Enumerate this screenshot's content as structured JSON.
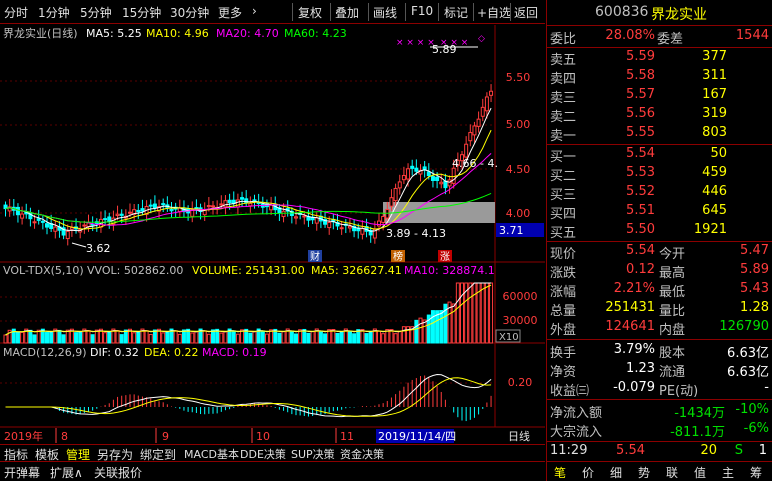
{
  "toolbar": {
    "periods": [
      "分时",
      "1分钟",
      "5分钟",
      "15分钟",
      "30分钟",
      "更多",
      "›"
    ],
    "buttons": [
      "复权",
      "叠加",
      "画线",
      "F10",
      "标记",
      "+自选",
      "返回"
    ]
  },
  "kline": {
    "title": "界龙实业(日线)",
    "ma5": "MA5: 5.25",
    "ma10": "MA10: 4.96",
    "ma20": "MA20: 4.70",
    "ma60": "MA60: 4.23",
    "ticks": [
      "5.50",
      "5.00",
      "4.50",
      "4.00"
    ],
    "high_label": "5.89",
    "low_label": "3.62",
    "range_label": "3.89 - 4.13",
    "mid_label": "4.66 - 4.",
    "price_tag": "3.71",
    "markers": [
      "财",
      "榜",
      "涨"
    ],
    "colors": {
      "ma5": "#ffffff",
      "ma10": "#ffff00",
      "ma20": "#ff00ff",
      "ma60": "#00ff00",
      "up": "#ff3c3c",
      "down": "#00ffff"
    }
  },
  "volume": {
    "title": "VOL-TDX(5,10)",
    "vvol": "VVOL: 502862.00",
    "vol": "VOLUME: 251431.00",
    "ma5": "MA5: 326627.41",
    "ma10": "MA10: 328874.1",
    "ticks": [
      "60000",
      "30000"
    ],
    "unit": "X10"
  },
  "macd": {
    "title": "MACD(12,26,9)",
    "dif": "DIF: 0.32",
    "dea": "DEA: 0.22",
    "macd": "MACD: 0.19",
    "ticks": [
      "0.20"
    ]
  },
  "timeaxis": {
    "labels": [
      "2019年",
      "8",
      "9",
      "10",
      "11"
    ],
    "cursor": "2019/11/14/四",
    "period": "日线"
  },
  "tabs1": [
    "指标",
    "模板",
    "管理",
    "另存为",
    "绑定到",
    "MACD基本",
    "DDE决策",
    "SUP决策",
    "资金决策"
  ],
  "tabs2": [
    "开弹幕",
    "扩展∧",
    "关联报价"
  ],
  "panel": {
    "code": "600836",
    "name": "界龙实业",
    "weibi_label": "委比",
    "weibi": "28.08%",
    "weicha_label": "委差",
    "weicha": "1544",
    "sells": [
      {
        "label": "卖五",
        "price": "5.59",
        "vol": "377"
      },
      {
        "label": "卖四",
        "price": "5.58",
        "vol": "311"
      },
      {
        "label": "卖三",
        "price": "5.57",
        "vol": "167"
      },
      {
        "label": "卖二",
        "price": "5.56",
        "vol": "319"
      },
      {
        "label": "卖一",
        "price": "5.55",
        "vol": "803"
      }
    ],
    "buys": [
      {
        "label": "买一",
        "price": "5.54",
        "vol": "50"
      },
      {
        "label": "买二",
        "price": "5.53",
        "vol": "459"
      },
      {
        "label": "买三",
        "price": "5.52",
        "vol": "446"
      },
      {
        "label": "买四",
        "price": "5.51",
        "vol": "645"
      },
      {
        "label": "买五",
        "price": "5.50",
        "vol": "1921"
      }
    ],
    "stats": [
      {
        "l1": "现价",
        "v1": "5.54",
        "c1": "red",
        "l2": "今开",
        "v2": "5.47",
        "c2": "red"
      },
      {
        "l1": "涨跌",
        "v1": "0.12",
        "c1": "red",
        "l2": "最高",
        "v2": "5.89",
        "c2": "red"
      },
      {
        "l1": "涨幅",
        "v1": "2.21%",
        "c1": "red",
        "l2": "最低",
        "v2": "5.43",
        "c2": "red"
      },
      {
        "l1": "总量",
        "v1": "251431",
        "c1": "yellow",
        "l2": "量比",
        "v2": "1.28",
        "c2": "yellow"
      },
      {
        "l1": "外盘",
        "v1": "124641",
        "c1": "red",
        "l2": "内盘",
        "v2": "126790",
        "c2": "green"
      }
    ],
    "stats2": [
      {
        "l1": "换手",
        "v1": "3.79%",
        "c1": "white",
        "l2": "股本",
        "v2": "6.63亿",
        "c2": "white"
      },
      {
        "l1": "净资",
        "v1": "1.23",
        "c1": "white",
        "l2": "流通",
        "v2": "6.63亿",
        "c2": "white"
      },
      {
        "l1": "收益㈢",
        "v1": "-0.079",
        "c1": "white",
        "l2": "PE(动)",
        "v2": "-",
        "c2": "white"
      }
    ],
    "flow": [
      {
        "label": "净流入额",
        "value": "-1434万",
        "pct": "-10%"
      },
      {
        "label": "大宗流入",
        "value": "-811.1万",
        "pct": "-6%"
      }
    ],
    "tick": {
      "time": "11:29",
      "price": "5.54",
      "vol": "20",
      "flag": "S",
      "count": "1"
    },
    "bottom_tabs": [
      "笔",
      "价",
      "细",
      "势",
      "联",
      "值",
      "主",
      "筹"
    ]
  }
}
